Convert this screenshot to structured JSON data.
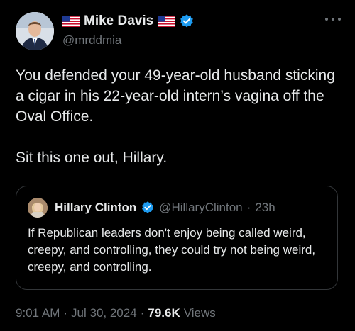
{
  "tweet": {
    "author": {
      "display_name": "Mike Davis",
      "handle": "@mrddmia",
      "avatar": "man-portrait-avatar",
      "decorations": [
        "us-flag-icon",
        "us-flag-icon"
      ],
      "verified_icon": "verified-badge-icon"
    },
    "more_icon": "more-options-icon",
    "text_paragraphs": [
      "You defended your 49-year-old husband sticking a cigar in his 22-year-old intern’s vagina off the Oval Office.",
      "Sit this one out, Hillary."
    ],
    "quoted_tweet": {
      "display_name": "Hillary Clinton",
      "handle": "@HillaryClinton",
      "separator": "·",
      "time": "23h",
      "avatar": "woman-portrait-avatar",
      "verified_icon": "verified-badge-icon",
      "text": "If Republican leaders don't enjoy being called weird, creepy, and controlling, they could try not being weird, creepy, and controlling."
    },
    "meta": {
      "time": "9:01 AM",
      "separator1": "·",
      "date": "Jul 30, 2024",
      "separator2": "·",
      "views_count": "79.6K",
      "views_label": "Views"
    }
  },
  "colors": {
    "background": "#000000",
    "primary_text": "#e7e9ea",
    "secondary_text": "#71767b",
    "verified_blue": "#1d9bf0",
    "border": "#333639"
  }
}
